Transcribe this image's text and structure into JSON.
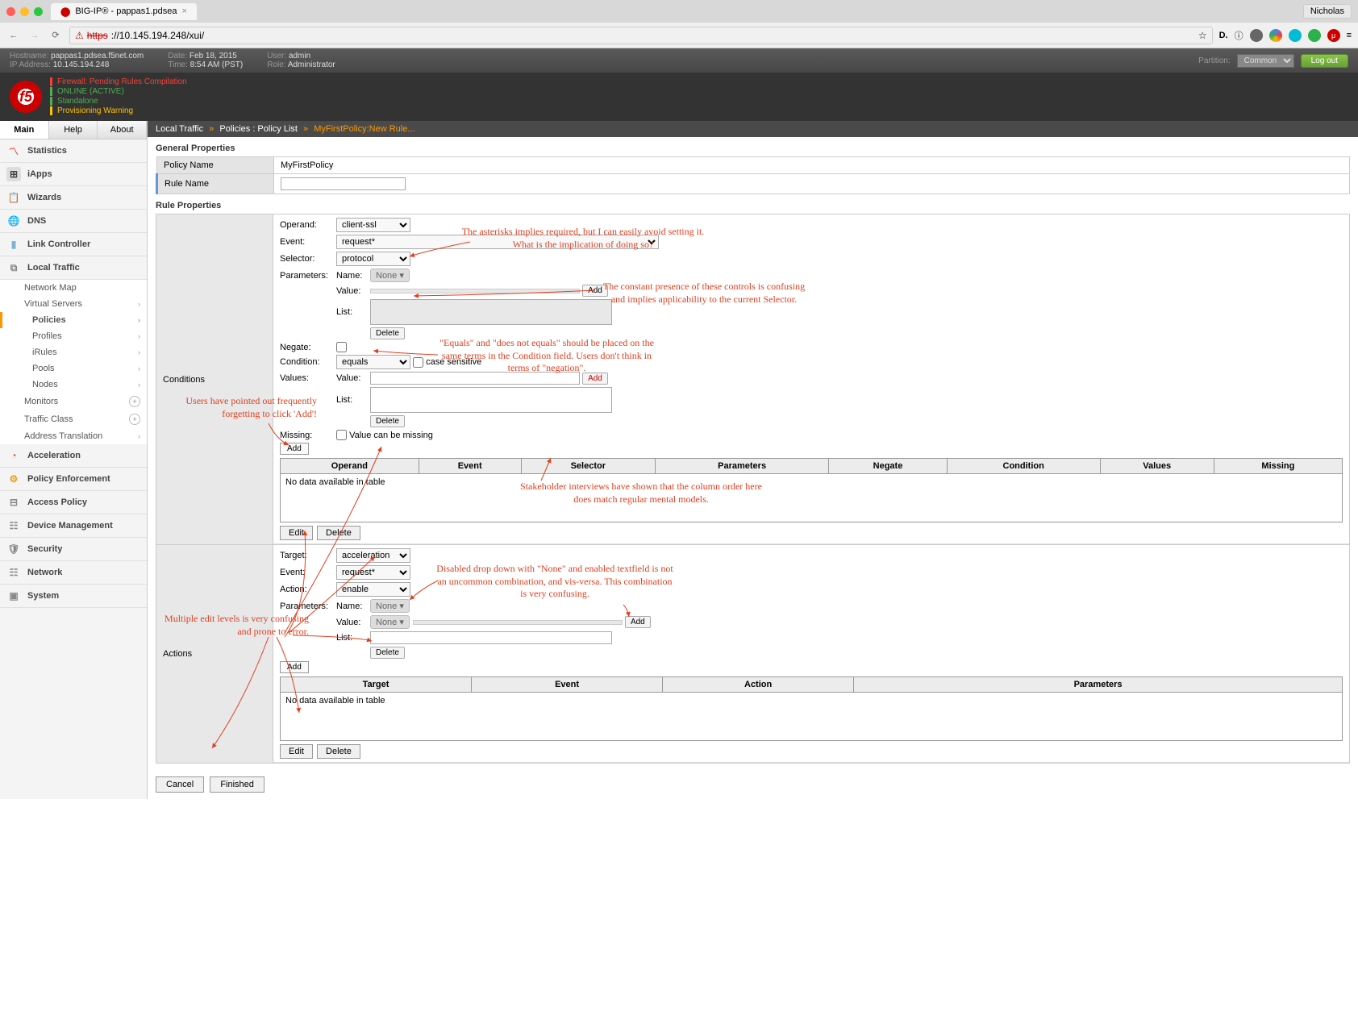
{
  "browser": {
    "tab_title": "BIG-IP® - pappas1.pdsea",
    "user": "Nicholas",
    "url_prefix": "https",
    "url": "://10.145.194.248/xui/"
  },
  "header": {
    "hostname_label": "Hostname:",
    "hostname": "pappas1.pdsea.f5net.com",
    "ip_label": "IP Address:",
    "ip": "10.145.194.248",
    "date_label": "Date:",
    "date": "Feb 18, 2015",
    "time_label": "Time:",
    "time": "8:54 AM (PST)",
    "user_label": "User:",
    "user": "admin",
    "role_label": "Role:",
    "role": "Administrator",
    "partition_label": "Partition:",
    "partition": "Common",
    "logout": "Log out"
  },
  "status": {
    "l1": "Firewall: Pending Rules Compilation",
    "l2": "ONLINE (ACTIVE)",
    "l3": "Standalone",
    "l4": "Provisioning Warning"
  },
  "sidebar_tabs": {
    "main": "Main",
    "help": "Help",
    "about": "About"
  },
  "nav": {
    "statistics": "Statistics",
    "iapps": "iApps",
    "wizards": "Wizards",
    "dns": "DNS",
    "link_controller": "Link Controller",
    "local_traffic": "Local Traffic",
    "lt": {
      "network_map": "Network Map",
      "virtual_servers": "Virtual Servers",
      "policies": "Policies",
      "profiles": "Profiles",
      "irules": "iRules",
      "pools": "Pools",
      "nodes": "Nodes",
      "monitors": "Monitors",
      "traffic_class": "Traffic Class",
      "address_translation": "Address Translation"
    },
    "acceleration": "Acceleration",
    "policy_enforcement": "Policy Enforcement",
    "access_policy": "Access Policy",
    "device_management": "Device Management",
    "security": "Security",
    "network": "Network",
    "system": "System"
  },
  "breadcrumb": {
    "p1": "Local Traffic",
    "p2": "Policies : Policy List",
    "p3": "MyFirstPolicy:New Rule..."
  },
  "general": {
    "title": "General Properties",
    "policy_name_label": "Policy Name",
    "policy_name": "MyFirstPolicy",
    "rule_name_label": "Rule Name",
    "rule_name": ""
  },
  "rule_props": {
    "title": "Rule Properties",
    "operand_label": "Operand:",
    "operand": "client-ssl",
    "event_label": "Event:",
    "event": "request*",
    "selector_label": "Selector:",
    "selector": "protocol",
    "parameters_label": "Parameters:",
    "name_label": "Name:",
    "name_combo": "None",
    "value_label": "Value:",
    "list_label": "List:",
    "add": "Add",
    "delete": "Delete",
    "negate_label": "Negate:",
    "condition_label": "Condition:",
    "condition": "equals",
    "case_sensitive": "case sensitive",
    "values_label": "Values:",
    "missing_label": "Missing:",
    "missing_cb": "Value can be missing",
    "conditions_side": "Conditions",
    "cond_cols": {
      "operand": "Operand",
      "event": "Event",
      "selector": "Selector",
      "parameters": "Parameters",
      "negate": "Negate",
      "condition": "Condition",
      "values": "Values",
      "missing": "Missing"
    },
    "no_data": "No data available in table",
    "edit": "Edit",
    "target_label": "Target:",
    "target": "acceleration",
    "action_event": "request*",
    "action_label": "Action:",
    "action": "enable",
    "action_value_combo": "None",
    "actions_side": "Actions",
    "action_cols": {
      "target": "Target",
      "event": "Event",
      "action": "Action",
      "parameters": "Parameters"
    }
  },
  "bottom": {
    "cancel": "Cancel",
    "finished": "Finished"
  },
  "annotations": {
    "a1": "The asterisks implies required, but I can easily avoid setting it. What is the implication of doing so?",
    "a2": "The constant presence of these controls is confusing and implies applicability to the current Selector.",
    "a3": "\"Equals\" and \"does not equals\" should be placed on the same terms in the Condition field. Users don't think in terms of \"negation\".",
    "a4": "Users have pointed out frequently forgetting to click 'Add'!",
    "a5": "Stakeholder interviews have shown that the column order here does match regular mental models.",
    "a6": "Disabled drop down with \"None\" and enabled textfield is not an uncommon combination, and vis-versa. This combination is very confusing.",
    "a7": "Multiple edit levels is very confusing and prone to error."
  }
}
